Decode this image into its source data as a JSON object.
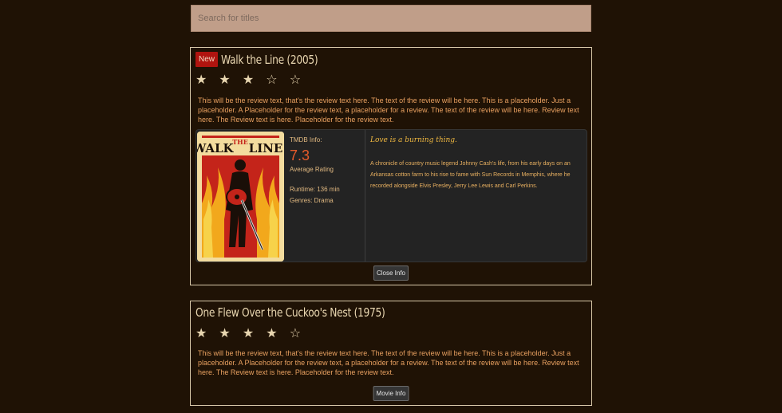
{
  "search": {
    "placeholder": "Search for titles"
  },
  "reviews": [
    {
      "badge": "New",
      "title": "Walk the Line (2005)",
      "stars": "★ ★ ★ ☆ ☆",
      "rating_value": 3,
      "rating_max": 5,
      "review_text": "This will be the review text, that's the review text here. The text of the review will be here. This is a placeholder. Just a placeholder. A Placeholder for the review text, a placeholder for a review. The text of the review will be here. Review text here. The Review text is here. Placeholder for the review text.",
      "info": {
        "poster_title_parts": [
          "WALK",
          "THE",
          "LINE"
        ],
        "tmdb_label": "TMDB Info:",
        "rating": "7.3",
        "average_label": "Average Rating",
        "runtime": "Runtime: 136 min",
        "genres": "Genres: Drama",
        "tagline": "Love is a burning thing.",
        "overview": "A chronicle of country music legend Johnny Cash's life, from his early days on an Arkansas cotton farm to his rise to fame with Sun Records in Memphis, where he recorded alongside Elvis Presley, Jerry Lee Lewis and Carl Perkins."
      },
      "button_label": "Close Info"
    },
    {
      "title": "One Flew Over the Cuckoo's Nest (1975)",
      "stars": "★ ★ ★ ★ ☆",
      "rating_value": 4,
      "rating_max": 5,
      "review_text": "This will be the review text, that's the review text here. The text of the review will be here. This is a placeholder. Just a placeholder. A Placeholder for the review text, a placeholder for a review. The text of the review will be here. Review text here. The Review text is here. Placeholder for the review text.",
      "button_label": "Movie Info"
    }
  ],
  "colors": {
    "background": "#1f1205",
    "search_bg": "#c09e89",
    "card_border": "#d8c8a8",
    "badge": "#b0140f",
    "review_text": "#e8a060",
    "rating": "#e55a2a",
    "tagline": "#f0b840",
    "panel_bg": "#232323"
  }
}
